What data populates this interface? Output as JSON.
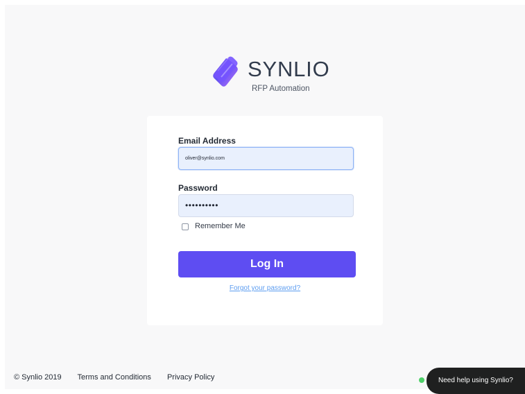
{
  "brand": {
    "name": "SYNLIO",
    "subtitle": "RFP Automation",
    "logo_icon": "synlio-logo-icon",
    "colors": {
      "accent_dark": "#5a48ef",
      "accent_light": "#a861ff"
    }
  },
  "form": {
    "email_label": "Email Address",
    "email_value": "oliver@synlio.com",
    "password_label": "Password",
    "password_value": "••••••••••",
    "remember_label": "Remember Me",
    "remember_checked": false,
    "login_label": "Log In",
    "forgot_label": "Forgot your password?"
  },
  "footer": {
    "copyright": "© Synlio 2019",
    "links": [
      "Terms and Conditions",
      "Privacy Policy"
    ]
  },
  "help": {
    "label": "Need help using Synlio?",
    "status_color": "#4fd16a"
  },
  "colors": {
    "page_bg": "#f8f8f9",
    "card_bg": "#ffffff",
    "primary_button": "#5e4df2",
    "link": "#5d9df0"
  }
}
